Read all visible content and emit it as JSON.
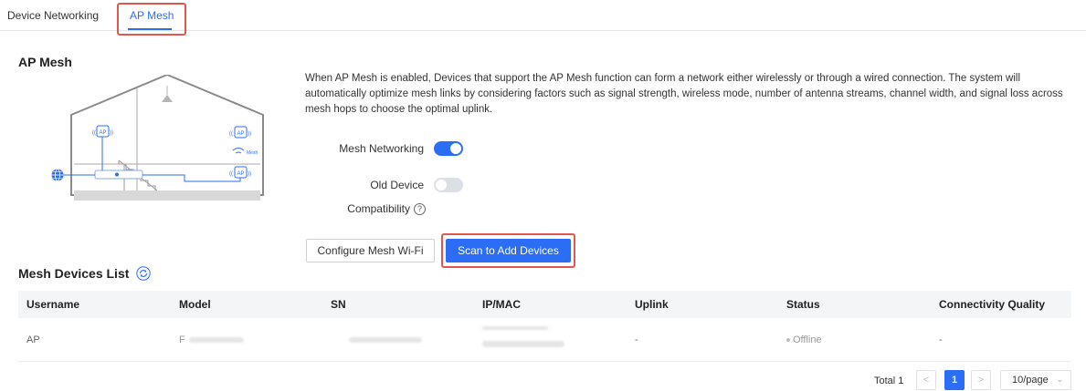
{
  "tabs": [
    {
      "label": "Device Networking"
    },
    {
      "label": "AP Mesh"
    }
  ],
  "section_title": "AP Mesh",
  "illustration": {
    "ap_label": "AP",
    "mesh_label": "Mesh"
  },
  "description": "When AP Mesh is enabled, Devices that support the AP Mesh function can form a network either wirelessly or through a wired connection. The system will automatically optimize mesh links by considering factors such as signal strength, wireless mode, number of antenna streams, channel width, and signal loss across mesh hops to choose the optimal uplink.",
  "settings": {
    "mesh_networking_label": "Mesh Networking",
    "mesh_networking_on": true,
    "old_device_label": "Old Device",
    "compatibility_label": "Compatibility",
    "old_device_compat_on": false,
    "help_glyph": "?"
  },
  "buttons": {
    "configure": "Configure Mesh Wi-Fi",
    "scan": "Scan to Add Devices"
  },
  "list": {
    "title": "Mesh Devices List",
    "columns": [
      "Username",
      "Model",
      "SN",
      "IP/MAC",
      "Uplink",
      "Status",
      "Connectivity Quality"
    ],
    "rows": [
      {
        "username": "AP",
        "model": "",
        "sn": "",
        "ip_mac": "",
        "uplink": "-",
        "status": "Offline",
        "quality": "-"
      }
    ]
  },
  "pagination": {
    "total": "Total 1",
    "prev_glyph": "<",
    "next_glyph": ">",
    "current_page": "1",
    "page_size": "10/page",
    "chevron": "⌄"
  },
  "colors": {
    "accent": "#2c6df6",
    "highlight": "#e0574f"
  }
}
